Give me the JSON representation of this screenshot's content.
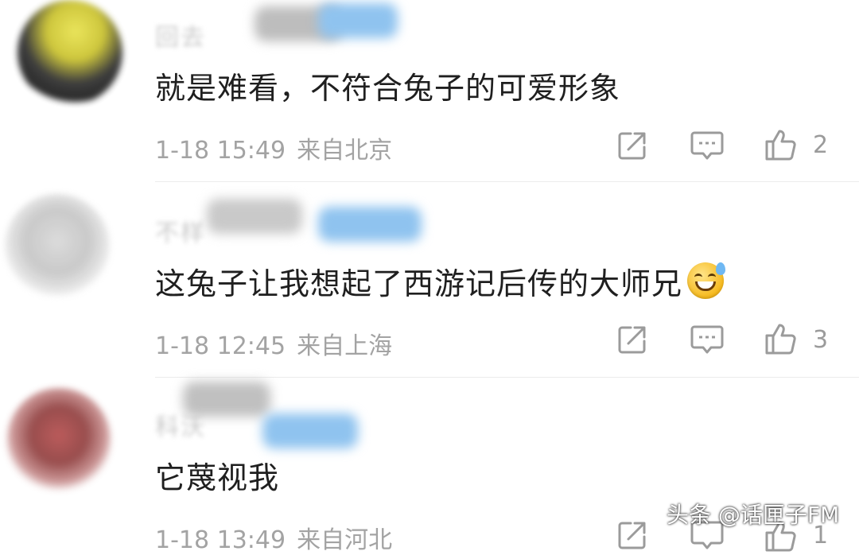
{
  "comments": [
    {
      "username": "回去",
      "text": "就是难看，不符合兔子的可爱形象",
      "time": "1-18 15:49",
      "location": "来自北京",
      "likes": "2"
    },
    {
      "username": "不样",
      "text": "这兔子让我想起了西游记后传的大师兄",
      "time": "1-18 12:45",
      "location": "来自上海",
      "likes": "3"
    },
    {
      "username": "科沃",
      "text": "它蔑视我",
      "time": "1-18 13:49",
      "location": "来自河北",
      "likes": "1"
    }
  ],
  "watermark": "头条 @话匣子FM",
  "colors": {
    "text": "#1f1f1f",
    "meta": "#a3a3a3",
    "divider": "#ececec",
    "smear_blue": "#8fc3ef"
  },
  "icons": [
    "share-icon",
    "comment-icon",
    "like-icon",
    "grinning-sweat-emoji"
  ]
}
